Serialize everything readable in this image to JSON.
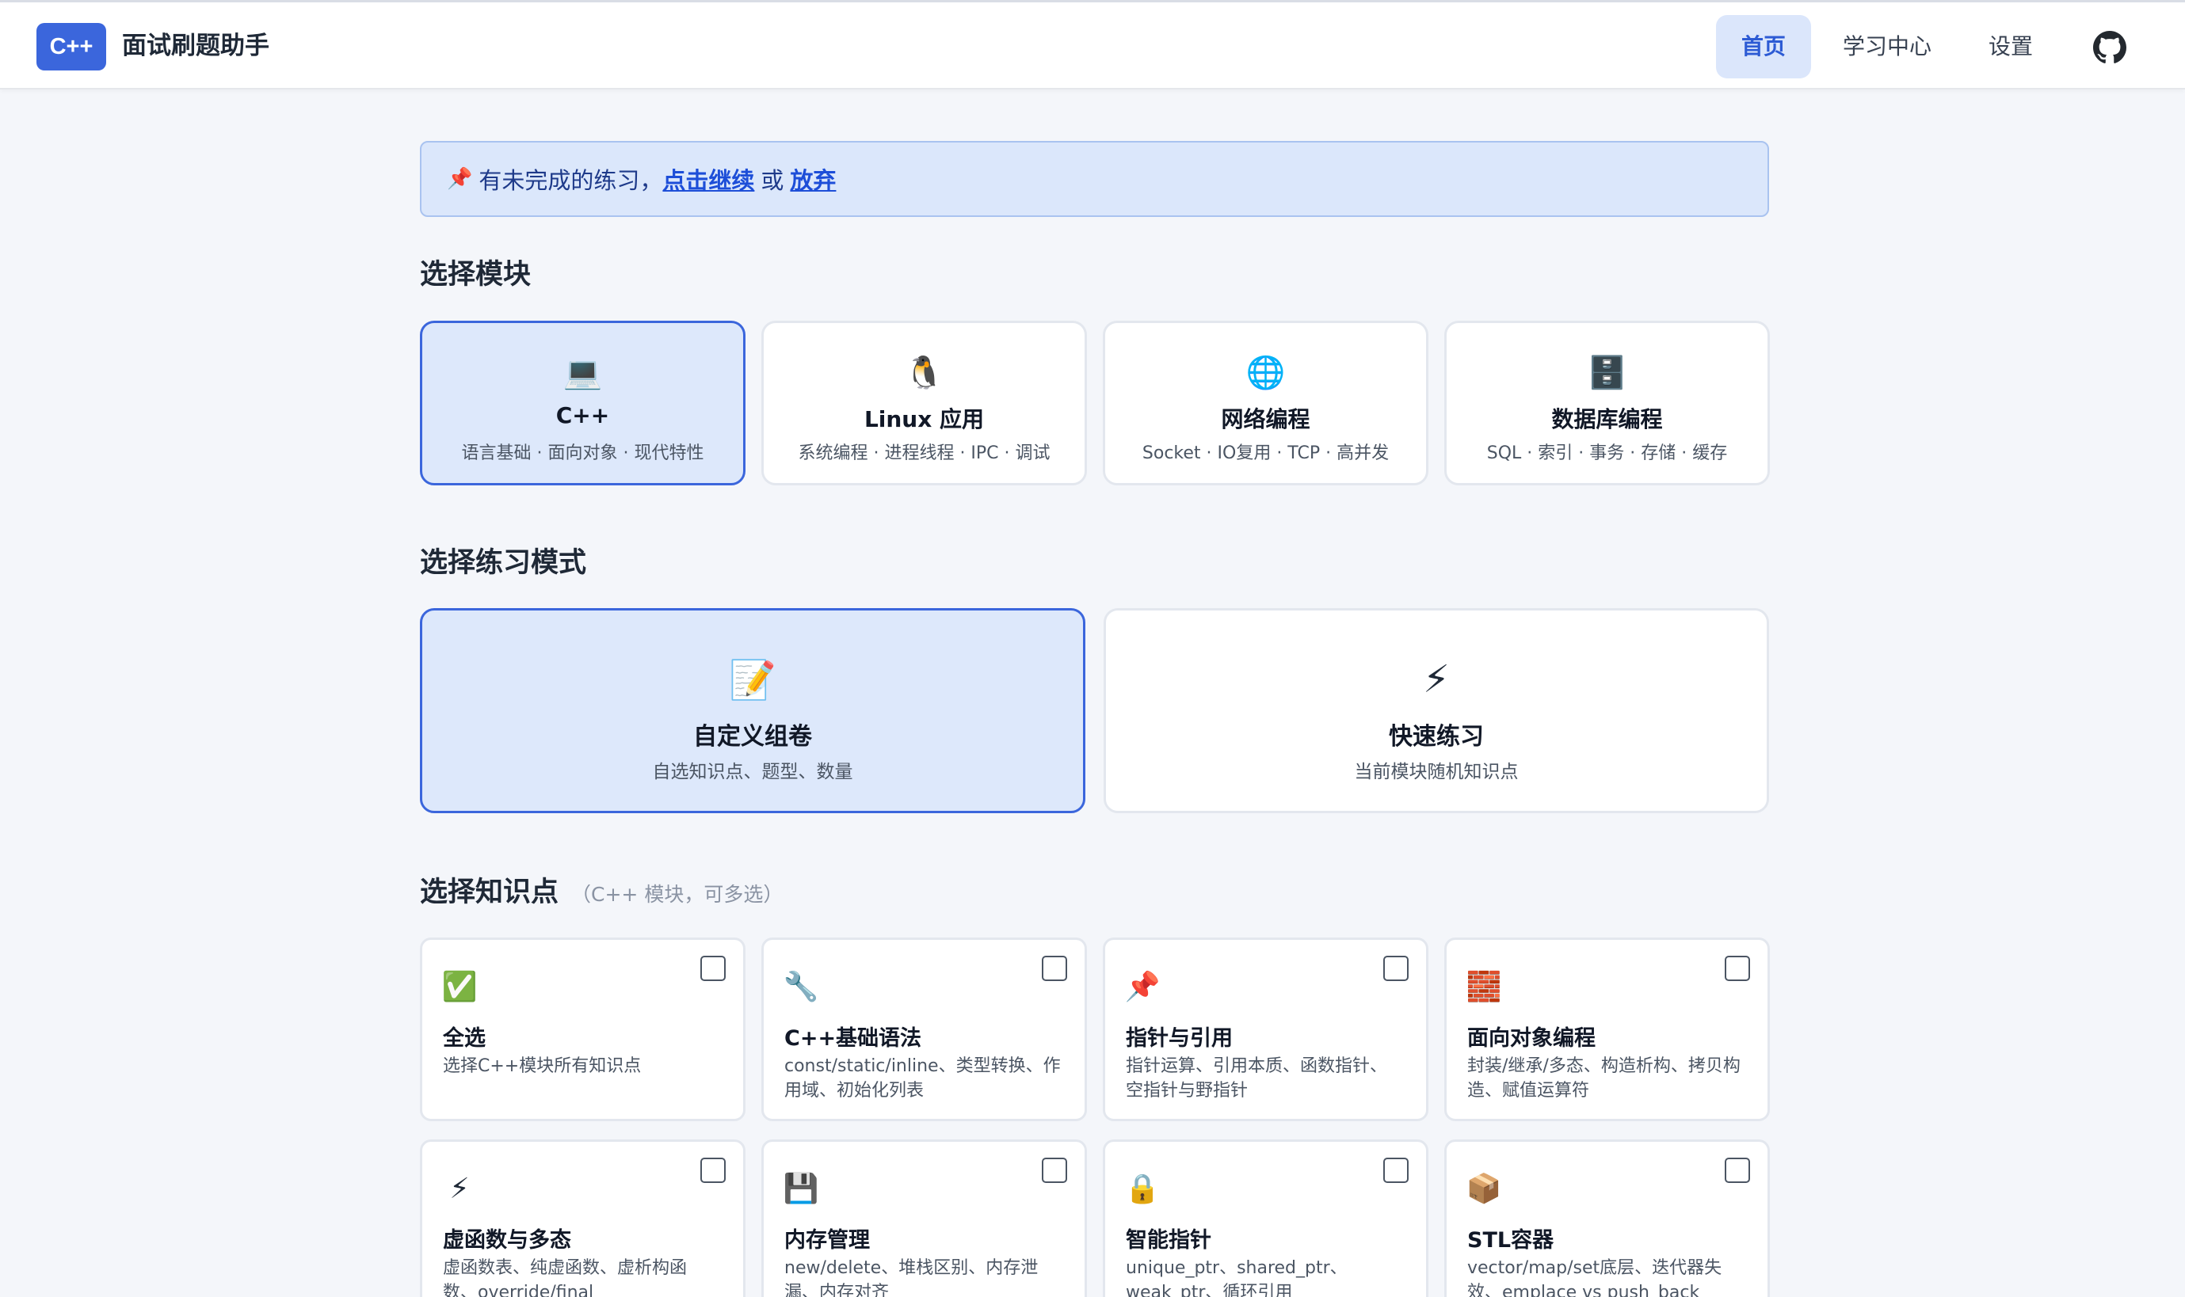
{
  "header": {
    "logo_text": "C++",
    "app_name": "面试刷题助手",
    "nav": [
      {
        "label": "首页",
        "active": true
      },
      {
        "label": "学习中心",
        "active": false
      },
      {
        "label": "设置",
        "active": false
      }
    ],
    "github_icon": "github-icon"
  },
  "notice": {
    "icon": "pushpin",
    "text": "有未完成的练习，",
    "continue_link": "点击继续",
    "or_text": "或",
    "abandon_link": "放弃"
  },
  "modules_section": {
    "title": "选择模块",
    "items": [
      {
        "icon": "laptop-icon",
        "title": "C++",
        "desc": "语言基础 · 面向对象 · 现代特性",
        "selected": true
      },
      {
        "icon": "penguin-icon",
        "title": "Linux 应用",
        "desc": "系统编程 · 进程线程 · IPC · 调试",
        "selected": false
      },
      {
        "icon": "globe-icon",
        "title": "网络编程",
        "desc": "Socket · IO复用 · TCP · 高并发",
        "selected": false
      },
      {
        "icon": "cabinet-icon",
        "title": "数据库编程",
        "desc": "SQL · 索引 · 事务 · 存储 · 缓存",
        "selected": false
      }
    ]
  },
  "mode_section": {
    "title": "选择练习模式",
    "items": [
      {
        "icon": "memo-icon",
        "title": "自定义组卷",
        "desc": "自选知识点、题型、数量",
        "selected": true
      },
      {
        "icon": "lightning-icon",
        "title": "快速练习",
        "desc": "当前模块随机知识点",
        "selected": false
      }
    ]
  },
  "topics_section": {
    "title": "选择知识点",
    "hint": "（C++ 模块，可多选）",
    "items": [
      {
        "icon": "check-mark-icon",
        "title": "全选",
        "desc": "选择C++模块所有知识点",
        "checked": false
      },
      {
        "icon": "wrench-icon",
        "title": "C++基础语法",
        "desc": "const/static/inline、类型转换、作用域、初始化列表",
        "checked": false
      },
      {
        "icon": "pushpin-icon",
        "title": "指针与引用",
        "desc": "指针运算、引用本质、函数指针、空指针与野指针",
        "checked": false
      },
      {
        "icon": "bricks-icon",
        "title": "面向对象编程",
        "desc": "封装/继承/多态、构造析构、拷贝构造、赋值运算符",
        "checked": false
      },
      {
        "icon": "lightning-icon",
        "title": "虚函数与多态",
        "desc": "虚函数表、纯虚函数、虚析构函数、override/final",
        "checked": false
      },
      {
        "icon": "floppy-disk-icon",
        "title": "内存管理",
        "desc": "new/delete、堆栈区别、内存泄漏、内存对齐",
        "checked": false
      },
      {
        "icon": "lock-icon",
        "title": "智能指针",
        "desc": "unique_ptr、shared_ptr、weak_ptr、循环引用",
        "checked": false
      },
      {
        "icon": "package-icon",
        "title": "STL容器",
        "desc": "vector/map/set底层、迭代器失效、emplace vs push_back",
        "checked": false
      }
    ]
  },
  "colors": {
    "accent": "#3b66dc",
    "selected_bg": "#dde8fb",
    "notice_bg": "#dbe7fb",
    "page_bg": "#f4f6fa"
  }
}
